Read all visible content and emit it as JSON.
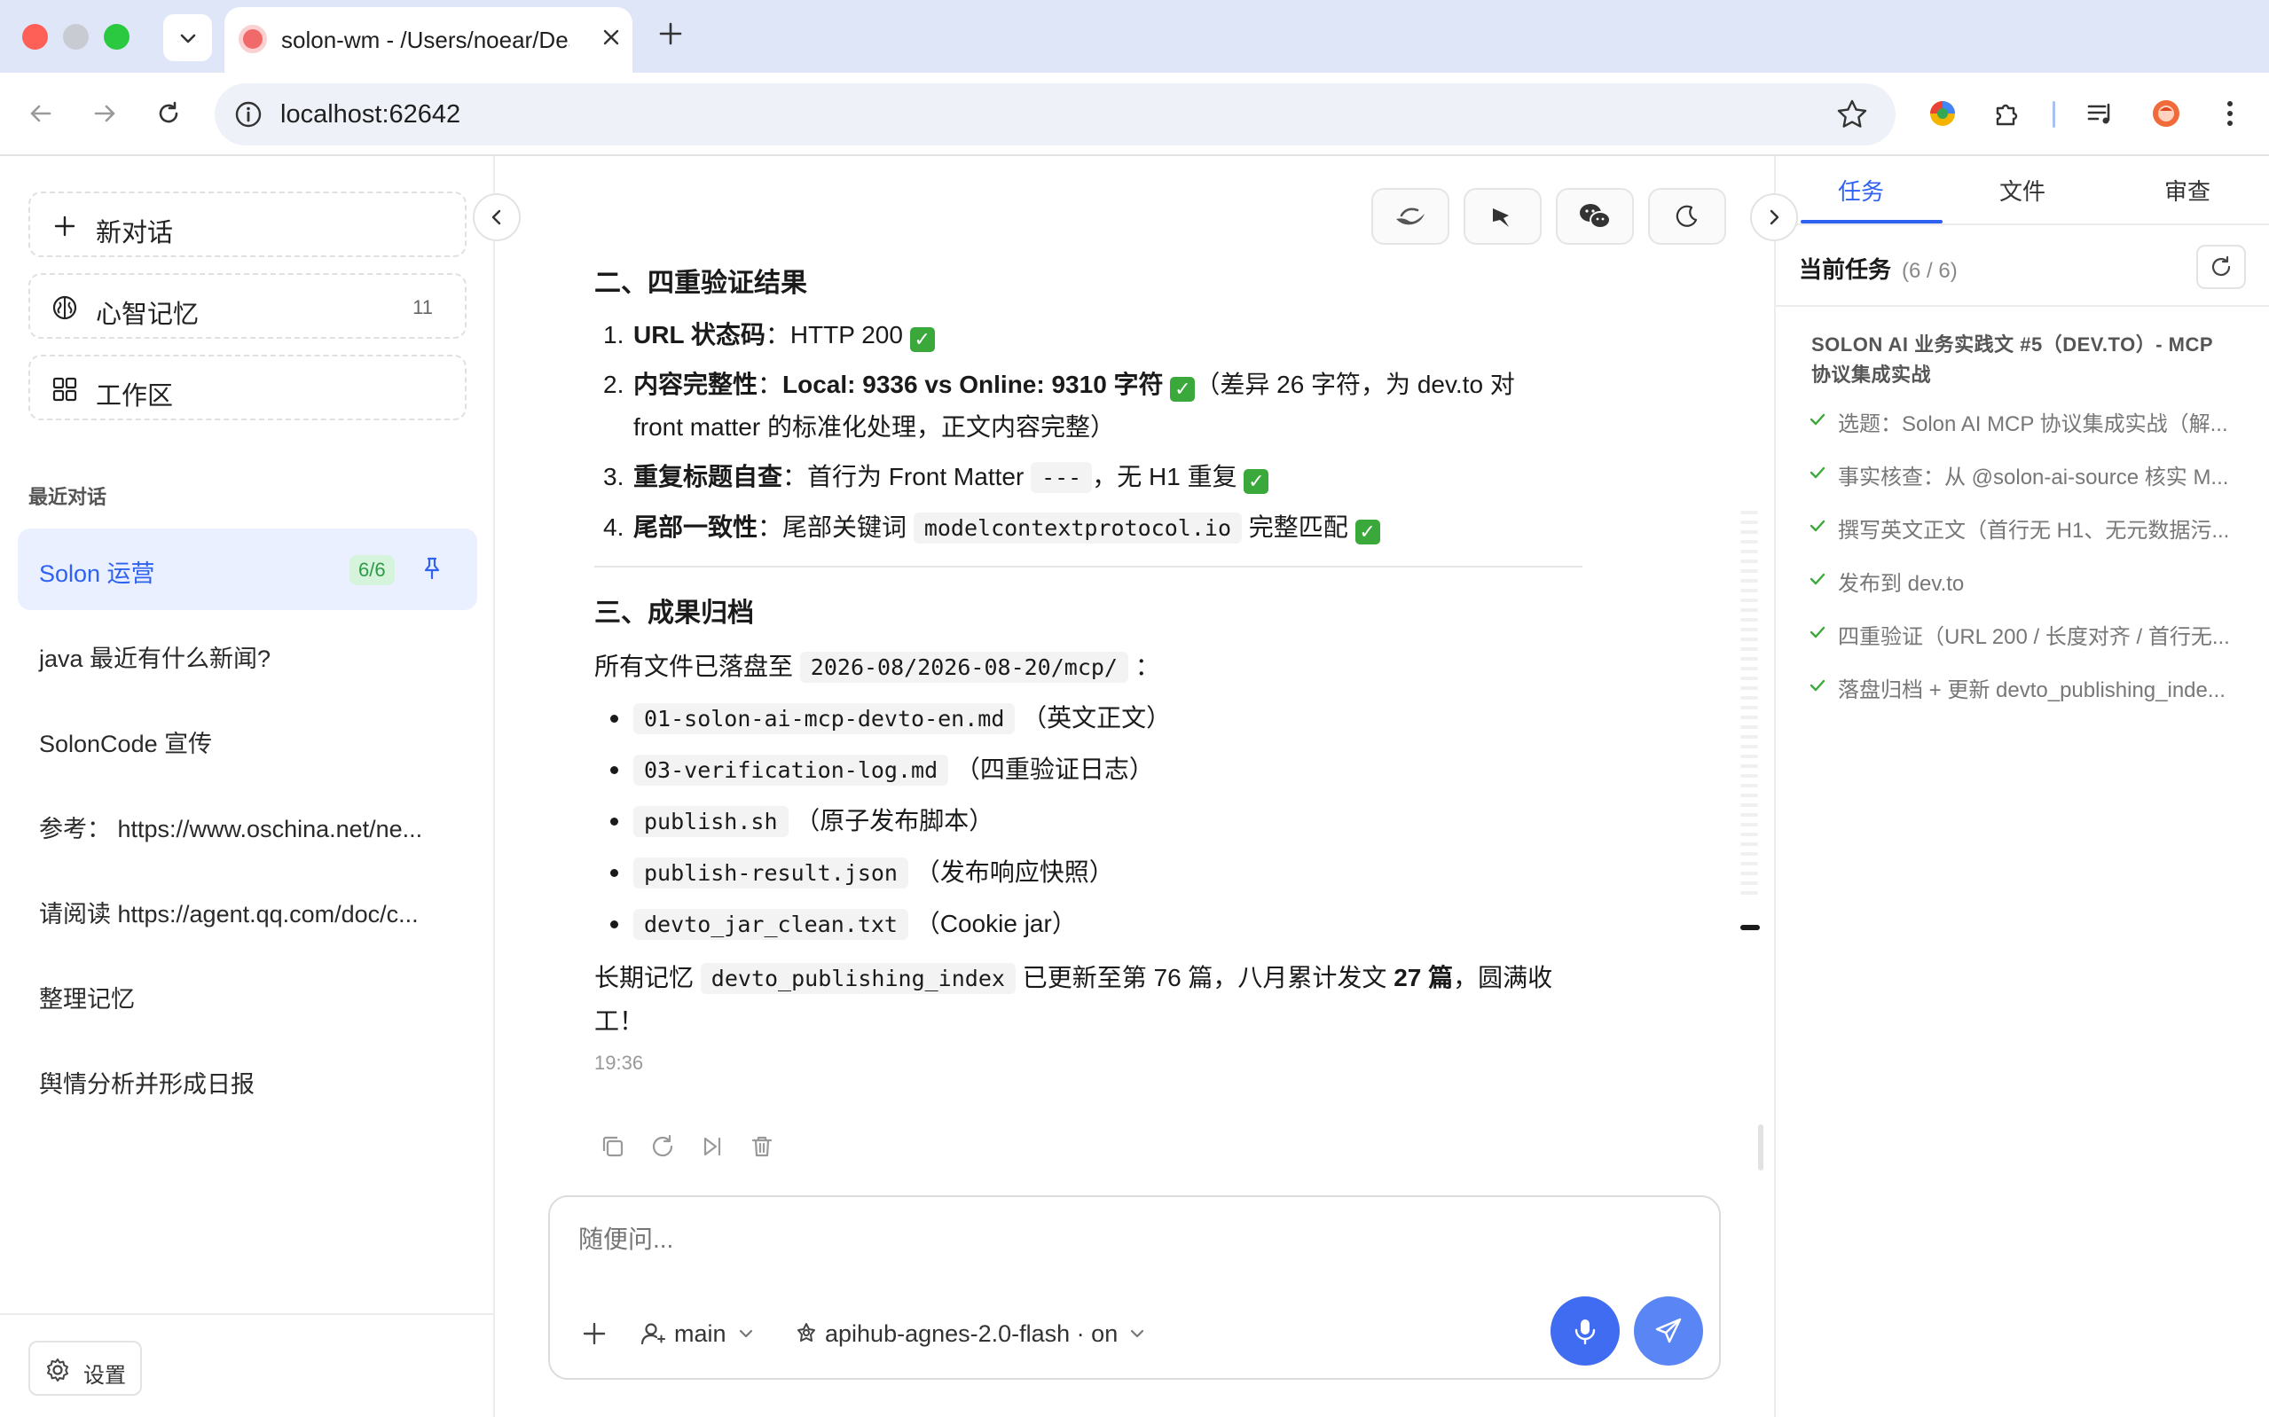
{
  "browser": {
    "tab_title": "solon-wm - /Users/noear/Desktop",
    "url": "localhost:62642"
  },
  "sidebar": {
    "new_chat": "新对话",
    "memory_label": "心智记忆",
    "memory_count": "11",
    "workspace_label": "工作区",
    "recent_heading": "最近对话",
    "conversations": [
      {
        "title": "Solon 运营",
        "badge": "6/6"
      },
      {
        "title": "java 最近有什么新闻?"
      },
      {
        "title": "SolonCode 宣传"
      },
      {
        "title": "参考： https://www.oschina.net/ne..."
      },
      {
        "title": "请阅读 https://agent.qq.com/doc/c..."
      },
      {
        "title": "整理记忆"
      },
      {
        "title": "舆情分析并形成日报"
      }
    ],
    "settings": "设置"
  },
  "message": {
    "section2_title": "二、四重验证结果",
    "v1_label": "URL 状态码",
    "v1_text": "：HTTP 200",
    "v2_label": "内容完整性",
    "v2_sep": "：",
    "v2_bold": "Local: 9336 vs Online: 9310 字符",
    "v2_text_a": "（差异 26 字符，为 dev.to 对",
    "v2_text_b": "front matter 的标准化处理，正文内容完整）",
    "v3_label": "重复标题自查",
    "v3_text_a": "：首行为 Front Matter",
    "v3_code": "---",
    "v3_text_b": "，无 H1 重复",
    "v4_label": "尾部一致性",
    "v4_text_a": "：尾部关键词",
    "v4_code": "modelcontextprotocol.io",
    "v4_text_b": "完整匹配",
    "section3_title": "三、成果归档",
    "archive_intro": "所有文件已落盘至",
    "archive_path": "2026-08/2026-08-20/mcp/",
    "archive_colon": "：",
    "files": [
      {
        "name": "01-solon-ai-mcp-devto-en.md",
        "desc": "（英文正文）"
      },
      {
        "name": "03-verification-log.md",
        "desc": "（四重验证日志）"
      },
      {
        "name": "publish.sh",
        "desc": "（原子发布脚本）"
      },
      {
        "name": "publish-result.json",
        "desc": "（发布响应快照）"
      },
      {
        "name": "devto_jar_clean.txt",
        "desc": "（Cookie jar）"
      }
    ],
    "closing_a": "长期记忆",
    "closing_code": "devto_publishing_index",
    "closing_b": "已更新至第 76 篇，八月累计发文",
    "closing_bold": "27 篇",
    "closing_c": "，圆满收",
    "closing_d": "工！",
    "time": "19:36"
  },
  "composer": {
    "placeholder": "随便问...",
    "agent": "main",
    "model": "apihub-agnes-2.0-flash · on"
  },
  "right_panel": {
    "tabs": [
      "任务",
      "文件",
      "审查"
    ],
    "current_task_label": "当前任务",
    "current_task_count": "(6 / 6)",
    "group_title": "SOLON AI 业务实践文 #5（DEV.TO）- MCP 协议集成实战",
    "tasks": [
      "选题：Solon AI MCP 协议集成实战（解...",
      "事实核查：从 @solon-ai-source 核实 M...",
      "撰写英文正文（首行无 H1、无元数据污...",
      "发布到 dev.to",
      "四重验证（URL 200 / 长度对齐 / 首行无...",
      "落盘归档 + 更新 devto_publishing_inde..."
    ]
  },
  "colors": {
    "accent": "#2f62f0",
    "send_button": "#3f6cf0",
    "success_badge_bg": "#d6f3dc",
    "success_badge_fg": "#2e9a49",
    "check_green": "#3aa83a"
  }
}
